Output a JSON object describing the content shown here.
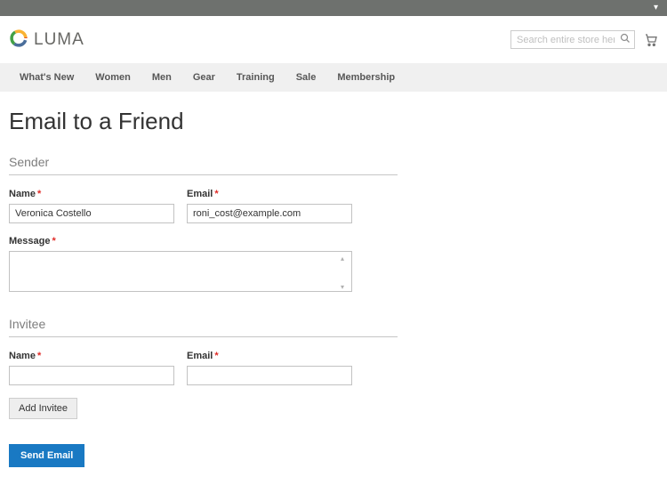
{
  "header": {
    "brand": "LUMA",
    "search_placeholder": "Search entire store here..."
  },
  "nav": {
    "items": [
      "What's New",
      "Women",
      "Men",
      "Gear",
      "Training",
      "Sale",
      "Membership"
    ]
  },
  "page": {
    "title": "Email to a Friend"
  },
  "sender": {
    "legend": "Sender",
    "name_label": "Name",
    "name_value": "Veronica Costello",
    "email_label": "Email",
    "email_value": "roni_cost@example.com",
    "message_label": "Message",
    "message_value": ""
  },
  "invitee": {
    "legend": "Invitee",
    "name_label": "Name",
    "name_value": "",
    "email_label": "Email",
    "email_value": "",
    "add_button": "Add Invitee"
  },
  "actions": {
    "send": "Send Email"
  },
  "required_mark": "*"
}
